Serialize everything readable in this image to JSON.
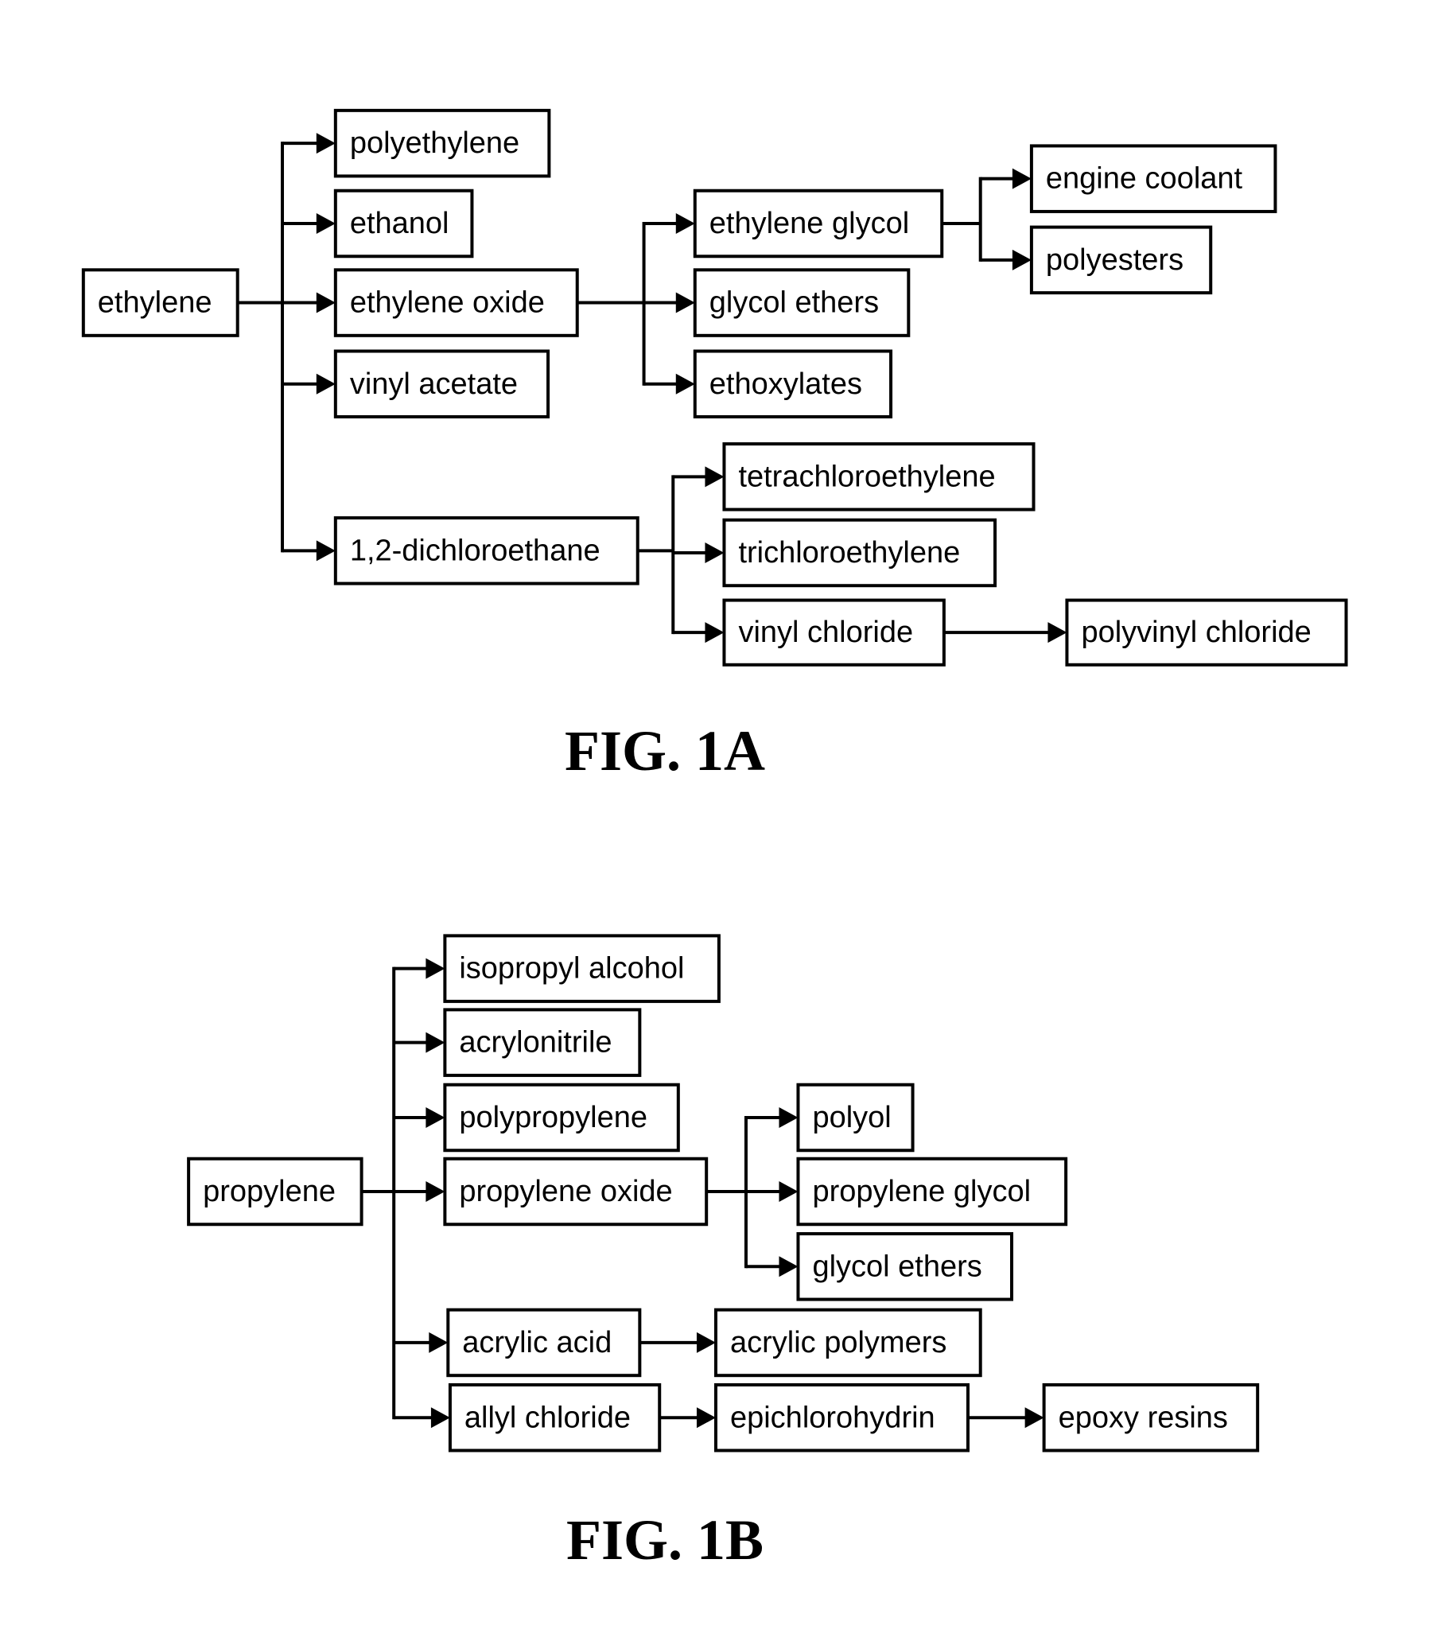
{
  "figures": [
    {
      "id": "fig1a",
      "caption": "FIG. 1A",
      "nodes": {
        "ethylene": "ethylene",
        "polyethylene": "polyethylene",
        "ethanol": "ethanol",
        "ethylene_oxide": "ethylene oxide",
        "vinyl_acetate": "vinyl acetate",
        "dichloroethane": "1,2-dichloroethane",
        "ethylene_glycol": "ethylene glycol",
        "glycol_ethers_a": "glycol ethers",
        "ethoxylates": "ethoxylates",
        "engine_coolant": "engine coolant",
        "polyesters": "polyesters",
        "tetrachloroethylene": "tetrachloroethylene",
        "trichloroethylene": "trichloroethylene",
        "vinyl_chloride": "vinyl chloride",
        "polyvinyl_chloride": "polyvinyl chloride"
      },
      "edges": [
        [
          "ethylene",
          "polyethylene"
        ],
        [
          "ethylene",
          "ethanol"
        ],
        [
          "ethylene",
          "ethylene_oxide"
        ],
        [
          "ethylene",
          "vinyl_acetate"
        ],
        [
          "ethylene",
          "dichloroethane"
        ],
        [
          "ethylene_oxide",
          "ethylene_glycol"
        ],
        [
          "ethylene_oxide",
          "glycol_ethers_a"
        ],
        [
          "ethylene_oxide",
          "ethoxylates"
        ],
        [
          "ethylene_glycol",
          "engine_coolant"
        ],
        [
          "ethylene_glycol",
          "polyesters"
        ],
        [
          "dichloroethane",
          "tetrachloroethylene"
        ],
        [
          "dichloroethane",
          "trichloroethylene"
        ],
        [
          "dichloroethane",
          "vinyl_chloride"
        ],
        [
          "vinyl_chloride",
          "polyvinyl_chloride"
        ]
      ]
    },
    {
      "id": "fig1b",
      "caption": "FIG. 1B",
      "nodes": {
        "propylene": "propylene",
        "isopropyl_alcohol": "isopropyl alcohol",
        "acrylonitrile": "acrylonitrile",
        "polypropylene": "polypropylene",
        "propylene_oxide": "propylene oxide",
        "acrylic_acid": "acrylic acid",
        "allyl_chloride": "allyl chloride",
        "polyol": "polyol",
        "propylene_glycol": "propylene glycol",
        "glycol_ethers_b": "glycol ethers",
        "acrylic_polymers": "acrylic polymers",
        "epichlorohydrin": "epichlorohydrin",
        "epoxy_resins": "epoxy resins"
      },
      "edges": [
        [
          "propylene",
          "isopropyl_alcohol"
        ],
        [
          "propylene",
          "acrylonitrile"
        ],
        [
          "propylene",
          "polypropylene"
        ],
        [
          "propylene",
          "propylene_oxide"
        ],
        [
          "propylene",
          "acrylic_acid"
        ],
        [
          "propylene",
          "allyl_chloride"
        ],
        [
          "propylene_oxide",
          "polyol"
        ],
        [
          "propylene_oxide",
          "propylene_glycol"
        ],
        [
          "propylene_oxide",
          "glycol_ethers_b"
        ],
        [
          "acrylic_acid",
          "acrylic_polymers"
        ],
        [
          "allyl_chloride",
          "epichlorohydrin"
        ],
        [
          "epichlorohydrin",
          "epoxy_resins"
        ]
      ]
    }
  ]
}
